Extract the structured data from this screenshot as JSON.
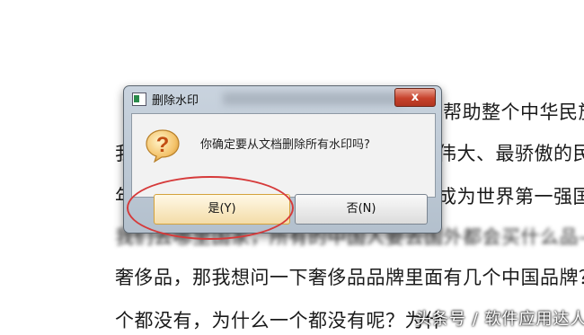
{
  "document": {
    "line1": "帮助整个中华民族",
    "line2_left": "我",
    "line2_right": "伟大、最骄傲的民",
    "line3_left": "年",
    "line3_right": "成为世界第一强国",
    "line4": "我们去哪里国家，所有的中国人要去国外都会买什么品—",
    "line5": "奢侈品，那我想问一下奢侈品品牌里面有几个中国品牌？",
    "line6": "个都没有，为什么一个都没有呢？为什",
    "watermark": "头条号 / 软件应用达人"
  },
  "dialog": {
    "title": "删除水印",
    "close_label": "x",
    "message": "你确定要从文档删除所有水印吗?",
    "yes_label": "是(Y)",
    "no_label": "否(N)"
  },
  "colors": {
    "annotation": "#d63a3a",
    "close_button": "#c7412b",
    "yes_highlight": "#f3dca8"
  },
  "icons": {
    "dialog_icon": "question-mark-icon",
    "title_icon": "app-icon"
  }
}
